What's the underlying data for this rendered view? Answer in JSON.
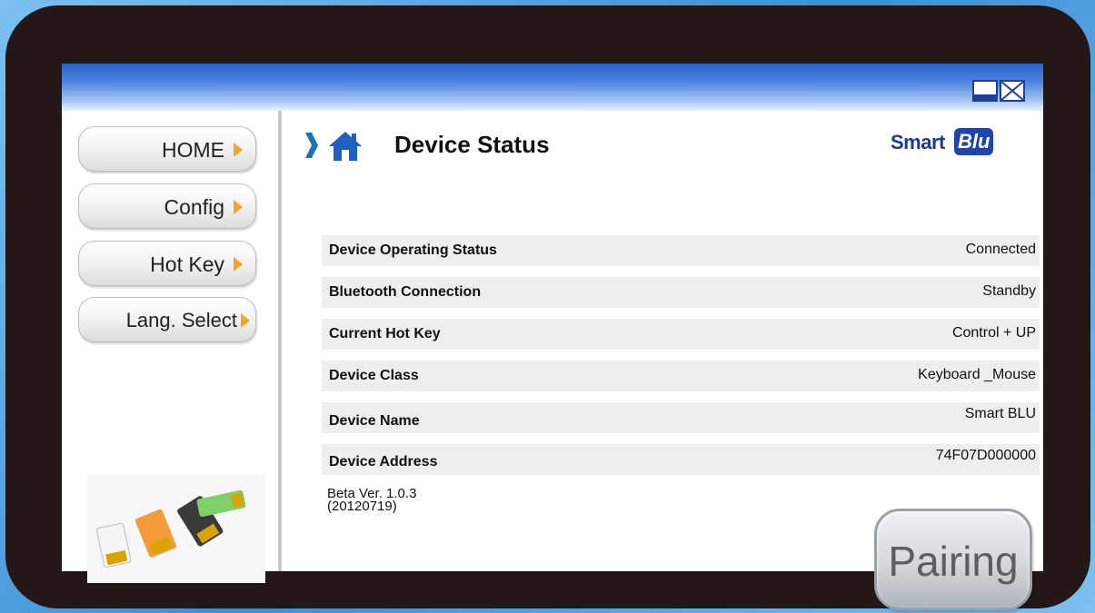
{
  "sidebar": {
    "items": [
      {
        "label": "HOME"
      },
      {
        "label": "Config"
      },
      {
        "label": "Hot Key"
      },
      {
        "label": "Lang. Select"
      }
    ]
  },
  "header": {
    "title": "Device Status",
    "logo_text_1": "Smart",
    "logo_text_2": "Blu"
  },
  "status": {
    "rows": [
      {
        "key": "Device Operating Status",
        "value": "Connected"
      },
      {
        "key": "Bluetooth Connection",
        "value": "Standby"
      },
      {
        "key": "Current  Hot Key",
        "value": "Control + UP"
      },
      {
        "key": "Device Class",
        "value": "Keyboard _Mouse"
      },
      {
        "key": "Device Name",
        "value": "Smart BLU"
      },
      {
        "key": "Device Address",
        "value": "74F07D000000"
      }
    ]
  },
  "version": {
    "line1": "Beta Ver. 1.0.3",
    "line2": "(20120719)"
  },
  "pairing": {
    "label": "Pairing"
  },
  "colors": {
    "titlebar": "#2a61c9",
    "accent_arrow": "#f0a52a",
    "header_chevron": "#1a73b8",
    "home_icon": "#1f5fbf",
    "frame": "#231815"
  },
  "icons": {
    "chevron": "chevron-right-icon",
    "home": "home-icon",
    "maximize": "maximize-icon",
    "close": "close-icon"
  }
}
